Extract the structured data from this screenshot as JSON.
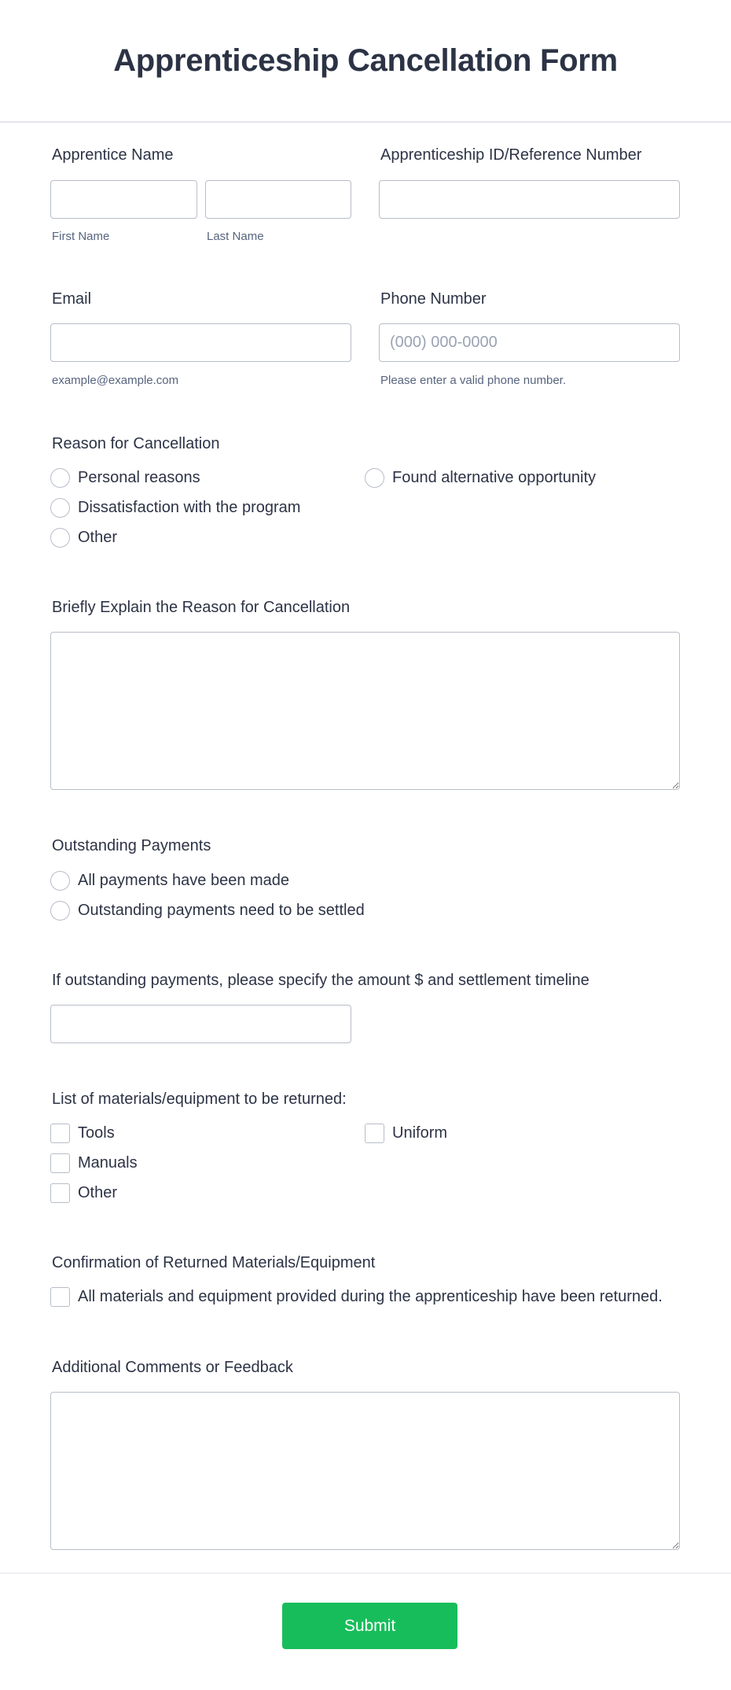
{
  "form": {
    "title": "Apprenticeship Cancellation Form",
    "apprentice_name": {
      "label": "Apprentice Name",
      "first": {
        "value": "",
        "sublabel": "First Name"
      },
      "last": {
        "value": "",
        "sublabel": "Last Name"
      }
    },
    "apprenticeship_id": {
      "label": "Apprenticeship ID/Reference Number",
      "value": ""
    },
    "email": {
      "label": "Email",
      "value": "",
      "sublabel": "example@example.com"
    },
    "phone": {
      "label": "Phone Number",
      "value": "",
      "placeholder": "(000) 000-0000",
      "sublabel": "Please enter a valid phone number."
    },
    "reason": {
      "label": "Reason for Cancellation",
      "options": [
        {
          "label": "Personal reasons",
          "selected": false
        },
        {
          "label": "Found alternative opportunity",
          "selected": false
        },
        {
          "label": "Dissatisfaction with the program",
          "selected": false
        },
        {
          "label": "Other",
          "selected": false
        }
      ]
    },
    "explain": {
      "label": "Briefly Explain the Reason for Cancellation",
      "value": ""
    },
    "payments": {
      "label": "Outstanding Payments",
      "options": [
        {
          "label": "All payments have been made",
          "selected": false
        },
        {
          "label": "Outstanding payments need to be settled",
          "selected": false
        }
      ]
    },
    "payment_details": {
      "label": "If outstanding payments, please specify the amount $ and settlement timeline",
      "value": ""
    },
    "materials": {
      "label": "List of materials/equipment to be returned:",
      "options": [
        {
          "label": "Tools",
          "checked": false
        },
        {
          "label": "Uniform",
          "checked": false
        },
        {
          "label": "Manuals",
          "checked": false
        },
        {
          "label": "Other",
          "checked": false
        }
      ]
    },
    "confirmation": {
      "label": "Confirmation of Returned Materials/Equipment",
      "option": {
        "label": "All materials and equipment provided during the apprenticeship have been returned.",
        "checked": false
      }
    },
    "comments": {
      "label": "Additional Comments or Feedback",
      "value": ""
    },
    "submit_label": "Submit",
    "colors": {
      "accent": "#18bd5b",
      "text": "#2c3345",
      "sublabel": "#57647e",
      "border": "#b8bdc9"
    }
  }
}
